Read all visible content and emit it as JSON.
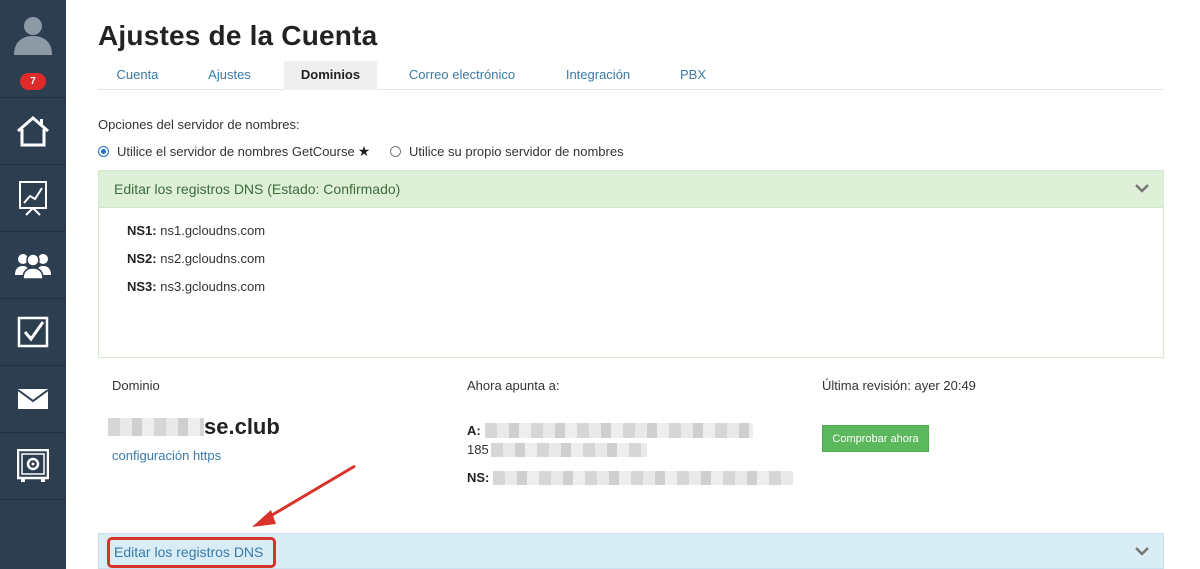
{
  "sidebar": {
    "notification_count": "7",
    "items": [
      {
        "name": "home"
      },
      {
        "name": "analytics"
      },
      {
        "name": "users"
      },
      {
        "name": "tasks"
      },
      {
        "name": "messages"
      },
      {
        "name": "settings"
      }
    ]
  },
  "page": {
    "title": "Ajustes de la Cuenta"
  },
  "tabs": [
    {
      "label": "Cuenta",
      "active": false
    },
    {
      "label": "Ajustes",
      "active": false
    },
    {
      "label": "Dominios",
      "active": true
    },
    {
      "label": "Correo electrónico",
      "active": false
    },
    {
      "label": "Integración",
      "active": false
    },
    {
      "label": "PBX",
      "active": false
    }
  ],
  "nameserver": {
    "label": "Opciones del servidor de nombres:",
    "option_getcourse": "Utilice el servidor de nombres GetCourse",
    "option_own": "Utilice su propio servidor de nombres",
    "selected": "getcourse"
  },
  "dns_panel": {
    "title": "Editar los registros DNS (Estado: Confirmado)",
    "records": [
      {
        "key": "NS1:",
        "value": "ns1.gcloudns.com"
      },
      {
        "key": "NS2:",
        "value": "ns2.gcloudns.com"
      },
      {
        "key": "NS3:",
        "value": "ns3.gcloudns.com"
      }
    ]
  },
  "domain_info": {
    "domain_label": "Dominio",
    "points_label": "Ahora apunta a:",
    "last_check_label": "Última revisión: ayer 20:49",
    "domain_suffix": "se.club",
    "https_link": "configuración https",
    "a_key": "A:",
    "a_second_line_prefix": "185",
    "ns_key": "NS:",
    "check_button": "Comprobar ahora"
  },
  "dns_panel_2": {
    "title": "Editar los registros DNS"
  },
  "colors": {
    "sidebar_bg": "#2c3e50",
    "badge": "#e02b2b",
    "link": "#3a7aa8",
    "success_panel": "#dff0d8",
    "info_panel": "#d9edf7",
    "button_green": "#5cb85c",
    "annotation_red": "#d9342b"
  }
}
